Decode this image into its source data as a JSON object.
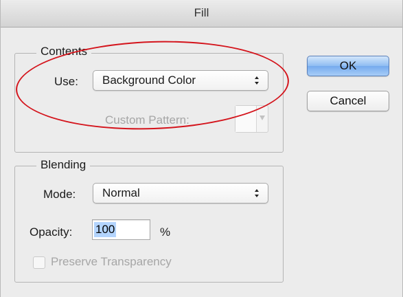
{
  "dialog": {
    "title": "Fill",
    "ok_label": "OK",
    "cancel_label": "Cancel"
  },
  "contents": {
    "legend": "Contents",
    "use_label": "Use:",
    "use_value": "Background Color",
    "custom_pattern_label": "Custom Pattern:"
  },
  "blending": {
    "legend": "Blending",
    "mode_label": "Mode:",
    "mode_value": "Normal",
    "opacity_label": "Opacity:",
    "opacity_value": "100",
    "opacity_unit": "%",
    "preserve_transparency_label": "Preserve Transparency",
    "preserve_transparency_checked": false
  },
  "colors": {
    "highlight_ellipse": "#d4141c",
    "ok_button": "#8fbcf2"
  }
}
